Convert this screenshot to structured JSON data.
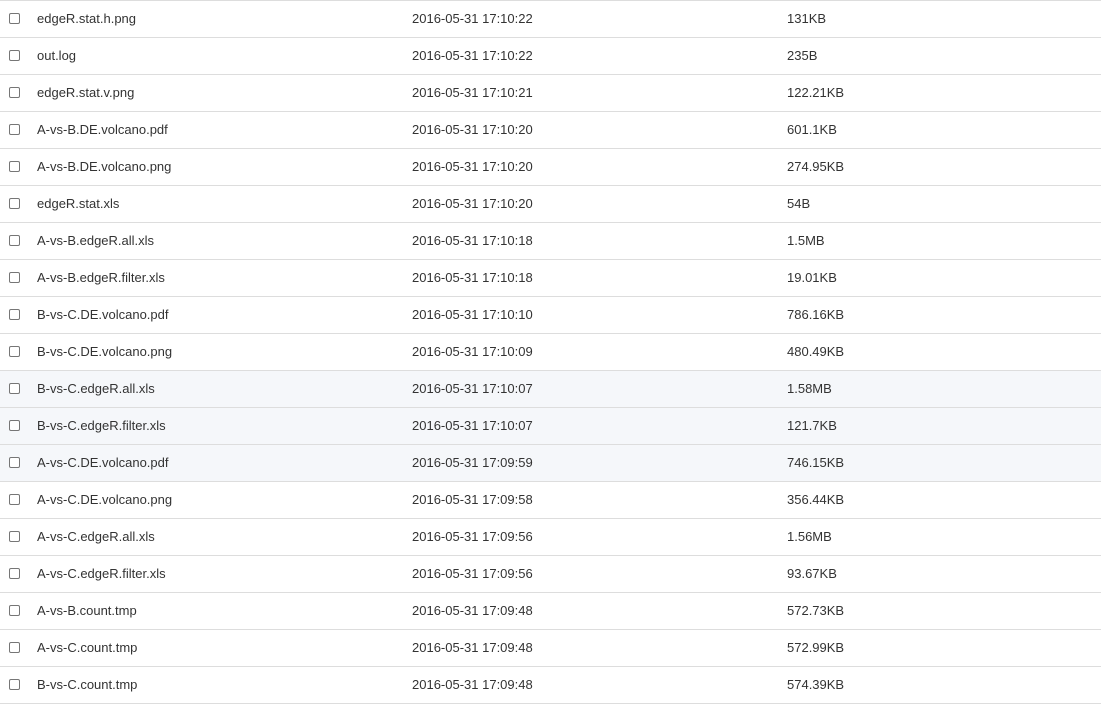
{
  "files": [
    {
      "name": "edgeR.stat.h.png",
      "modified": "2016-05-31 17:10:22",
      "size": "131KB"
    },
    {
      "name": "out.log",
      "modified": "2016-05-31 17:10:22",
      "size": "235B"
    },
    {
      "name": "edgeR.stat.v.png",
      "modified": "2016-05-31 17:10:21",
      "size": "122.21KB"
    },
    {
      "name": "A-vs-B.DE.volcano.pdf",
      "modified": "2016-05-31 17:10:20",
      "size": "601.1KB"
    },
    {
      "name": "A-vs-B.DE.volcano.png",
      "modified": "2016-05-31 17:10:20",
      "size": "274.95KB"
    },
    {
      "name": "edgeR.stat.xls",
      "modified": "2016-05-31 17:10:20",
      "size": "54B"
    },
    {
      "name": "A-vs-B.edgeR.all.xls",
      "modified": "2016-05-31 17:10:18",
      "size": "1.5MB"
    },
    {
      "name": "A-vs-B.edgeR.filter.xls",
      "modified": "2016-05-31 17:10:18",
      "size": "19.01KB"
    },
    {
      "name": "B-vs-C.DE.volcano.pdf",
      "modified": "2016-05-31 17:10:10",
      "size": "786.16KB"
    },
    {
      "name": "B-vs-C.DE.volcano.png",
      "modified": "2016-05-31 17:10:09",
      "size": "480.49KB"
    },
    {
      "name": "B-vs-C.edgeR.all.xls",
      "modified": "2016-05-31 17:10:07",
      "size": "1.58MB"
    },
    {
      "name": "B-vs-C.edgeR.filter.xls",
      "modified": "2016-05-31 17:10:07",
      "size": "121.7KB"
    },
    {
      "name": "A-vs-C.DE.volcano.pdf",
      "modified": "2016-05-31 17:09:59",
      "size": "746.15KB"
    },
    {
      "name": "A-vs-C.DE.volcano.png",
      "modified": "2016-05-31 17:09:58",
      "size": "356.44KB"
    },
    {
      "name": "A-vs-C.edgeR.all.xls",
      "modified": "2016-05-31 17:09:56",
      "size": "1.56MB"
    },
    {
      "name": "A-vs-C.edgeR.filter.xls",
      "modified": "2016-05-31 17:09:56",
      "size": "93.67KB"
    },
    {
      "name": "A-vs-B.count.tmp",
      "modified": "2016-05-31 17:09:48",
      "size": "572.73KB"
    },
    {
      "name": "A-vs-C.count.tmp",
      "modified": "2016-05-31 17:09:48",
      "size": "572.99KB"
    },
    {
      "name": "B-vs-C.count.tmp",
      "modified": "2016-05-31 17:09:48",
      "size": "574.39KB"
    }
  ],
  "colors": {
    "row_border": "#dddddd",
    "row_highlight": "#f5f7fa",
    "text": "#333333"
  },
  "highlighted_rows": [
    10,
    11,
    12
  ]
}
